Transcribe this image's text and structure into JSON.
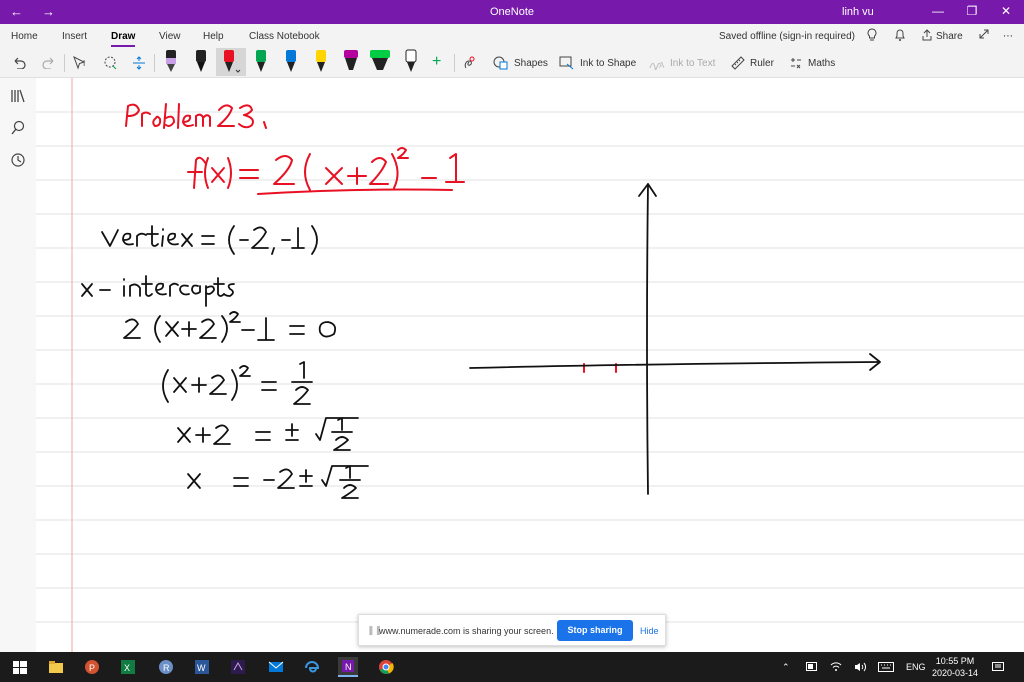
{
  "titlebar": {
    "title": "OneNote",
    "user": "linh vu",
    "accent": "#7719aa"
  },
  "menu": {
    "tabs": [
      "Home",
      "Insert",
      "Draw",
      "View",
      "Help",
      "Class Notebook"
    ],
    "active_tab": "Draw",
    "status": "Saved offline (sign-in required)",
    "share_label": "Share"
  },
  "toolbar": {
    "shapes_label": "Shapes",
    "ink_to_shape_label": "Ink to Shape",
    "ink_to_text_label": "Ink to Text",
    "ruler_label": "Ruler",
    "maths_label": "Maths",
    "pen_colors": [
      "#000000",
      "#000000",
      "#e81123",
      "#00a651",
      "#0078d7",
      "#ffd400",
      "#b4009e",
      "#00cc44",
      "#000000"
    ]
  },
  "sidebar": {
    "icons": [
      "notebooks-icon",
      "search-icon",
      "recent-icon"
    ]
  },
  "notes": {
    "ink_red": "#e81123",
    "ink_black": "#111111"
  },
  "share_bar": {
    "message": "www.numerade.com is sharing your screen.",
    "stop_label": "Stop sharing",
    "hide_label": "Hide"
  },
  "taskbar": {
    "language": "ENG",
    "time": "10:55 PM",
    "date": "2020-03-14",
    "apps": [
      "windows-icon",
      "file-explorer-icon",
      "powerpoint-icon",
      "excel-icon",
      "r-icon",
      "word-icon",
      "vs-icon",
      "mail-icon",
      "edge-icon",
      "onenote-icon",
      "chrome-icon"
    ]
  }
}
